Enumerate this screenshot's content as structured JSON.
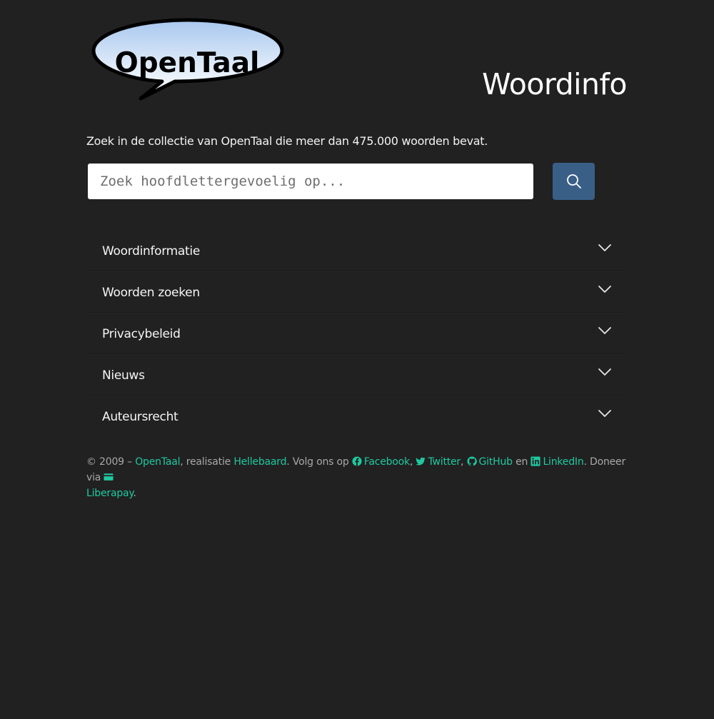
{
  "header": {
    "logo_text": "OpenTaal",
    "title": "Woordinfo"
  },
  "intro": "Zoek in de collectie van OpenTaal die meer dan 475.000 woorden bevat.",
  "search": {
    "placeholder": "Zoek hoofdlettergevoelig op...",
    "value": ""
  },
  "sections": [
    {
      "label": "Woordinformatie"
    },
    {
      "label": "Woorden zoeken"
    },
    {
      "label": "Privacybeleid"
    },
    {
      "label": "Nieuws"
    },
    {
      "label": "Auteursrecht"
    }
  ],
  "footer": {
    "copyright": "© 2009 – ",
    "opentaal_link": "OpenTaal",
    "text_realisatie": ", realisatie ",
    "hellebaard_link": "Hellebaard",
    "text_volg": ". Volg ons op ",
    "facebook_link": "Facebook",
    "comma1": ", ",
    "twitter_link": "Twitter",
    "comma2": ", ",
    "github_link": "GitHub",
    "text_en": " en ",
    "linkedin_link": "LinkedIn",
    "text_doneer": ". Doneer via ",
    "liberapay_link": "Liberapay",
    "period": "."
  },
  "colors": {
    "background": "#212121",
    "link": "#1fc9a0",
    "search_button": "#3a5f87"
  },
  "icons": {
    "search_button": "search-icon",
    "accordion": "chevron-down-icon",
    "facebook": "facebook-icon",
    "twitter": "twitter-icon",
    "github": "github-icon",
    "linkedin": "linkedin-icon",
    "liberapay": "credit-card-icon"
  }
}
